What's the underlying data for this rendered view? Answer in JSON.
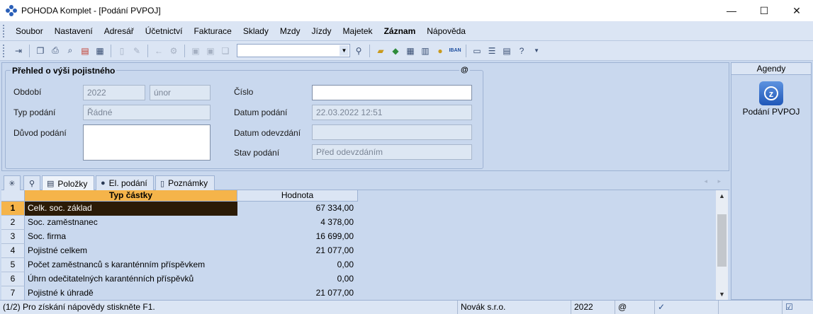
{
  "window": {
    "title": "POHODA Komplet - [Podání PVPOJ]",
    "minimize_glyph": "—",
    "maximize_glyph": "☐",
    "close_glyph": "✕"
  },
  "menu": [
    {
      "label": "Soubor",
      "bold": false
    },
    {
      "label": "Nastavení",
      "bold": false
    },
    {
      "label": "Adresář",
      "bold": false
    },
    {
      "label": "Účetnictví",
      "bold": false
    },
    {
      "label": "Fakturace",
      "bold": false
    },
    {
      "label": "Sklady",
      "bold": false
    },
    {
      "label": "Mzdy",
      "bold": false
    },
    {
      "label": "Jízdy",
      "bold": false
    },
    {
      "label": "Majetek",
      "bold": false
    },
    {
      "label": "Záznam",
      "bold": true
    },
    {
      "label": "Nápověda",
      "bold": false
    }
  ],
  "toolbar": {
    "iban_label": "IBAN",
    "search_combo_value": ""
  },
  "form": {
    "group_title": "Přehled o výši pojistného",
    "group_at": "@",
    "obdobi_label": "Období",
    "obdobi_year": "2022",
    "obdobi_month": "únor",
    "typ_podani_label": "Typ podání",
    "typ_podani_value": "Řádné",
    "duvod_podani_label": "Důvod podání",
    "duvod_podani_value": "",
    "cislo_label": "Číslo",
    "cislo_value": "",
    "datum_podani_label": "Datum podání",
    "datum_podani_value": "22.03.2022 12:51",
    "datum_odevzdani_label": "Datum odevzdání",
    "datum_odevzdani_value": "",
    "stav_podani_label": "Stav podání",
    "stav_podani_value": "Před odevzdáním"
  },
  "agenda": {
    "header": "Agendy",
    "item_label": "Podání PVPOJ"
  },
  "tabs": {
    "star_glyph": "✳",
    "filter_glyph": "⚲",
    "polozky": "Položky",
    "el_podani": "El. podání",
    "poznamky": "Poznámky",
    "nav_glyphs": "◂ ▸"
  },
  "grid": {
    "col_typ": "Typ částky",
    "col_hodnota": "Hodnota",
    "rows": [
      {
        "num": "1",
        "typ": "Celk. soc. základ",
        "hodnota": "67 334,00"
      },
      {
        "num": "2",
        "typ": "Soc. zaměstnanec",
        "hodnota": "4 378,00"
      },
      {
        "num": "3",
        "typ": "Soc. firma",
        "hodnota": "16 699,00"
      },
      {
        "num": "4",
        "typ": "Pojistné celkem",
        "hodnota": "21 077,00"
      },
      {
        "num": "5",
        "typ": "Počet zaměstnanců s karanténním příspěvkem",
        "hodnota": "0,00"
      },
      {
        "num": "6",
        "typ": "Úhrn odečitatelných karanténních příspěvků",
        "hodnota": "0,00"
      },
      {
        "num": "7",
        "typ": "Pojistné k úhradě",
        "hodnota": "21 077,00"
      }
    ]
  },
  "status": {
    "hint": "(1/2) Pro získání nápovědy stiskněte F1.",
    "company": "Novák s.r.o.",
    "year": "2022",
    "at": "@"
  },
  "colors": {
    "selection_header": "#f5b44a",
    "selection_row": "#2b1b07",
    "panel": "#c9d8ee"
  }
}
